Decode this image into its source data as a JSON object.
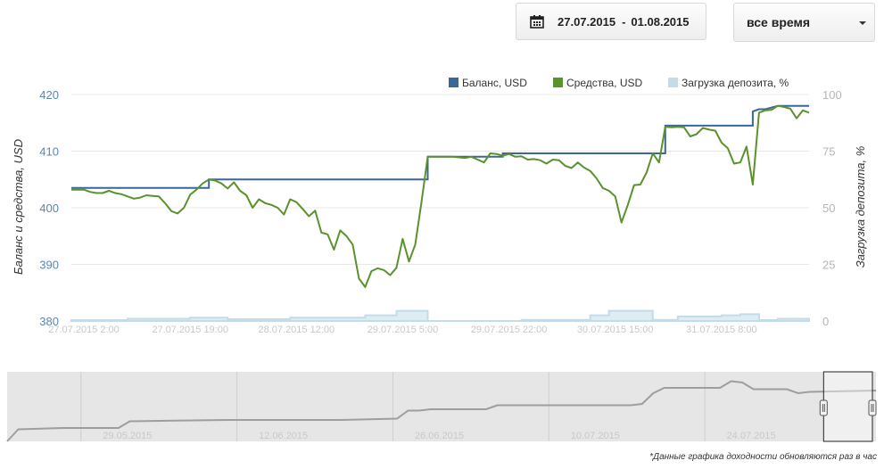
{
  "toolbar": {
    "date_from": "27.07.2015",
    "date_sep": "-",
    "date_to": "01.08.2015",
    "period_label": "все время",
    "calendar_icon": "calendar-icon",
    "dropdown_icon": "caret-down-icon"
  },
  "footnote": "*Данные графика доходности обновляются раз в час",
  "colors": {
    "balance": "#3a6797",
    "equity": "#5a922c",
    "deposit_load": "#c3dce9",
    "navigator": "#999999"
  },
  "chart_data": [
    {
      "type": "line",
      "legend_position": "top-right",
      "grid": true,
      "ylabel": "Баланс и средства, USD",
      "ylabel_right": "Загрузка депозита, %",
      "ylim": [
        380,
        420
      ],
      "yticks": [
        380,
        390,
        400,
        410,
        420
      ],
      "ylim_right": [
        0,
        100
      ],
      "yticks_right": [
        0,
        25,
        50,
        75,
        100
      ],
      "xlim": [
        0,
        118
      ],
      "x_unit": "hours since 27.07.2015 00:00",
      "xtick_labels": [
        {
          "x": 2,
          "label": "27.07.2015 2:00"
        },
        {
          "x": 19,
          "label": "27.07.2015 19:00"
        },
        {
          "x": 36,
          "label": "28.07.2015 12:00"
        },
        {
          "x": 53,
          "label": "29.07.2015 5:00"
        },
        {
          "x": 70,
          "label": "29.07.2015 22:00"
        },
        {
          "x": 87,
          "label": "30.07.2015 15:00"
        },
        {
          "x": 104,
          "label": "31.07.2015 8:00"
        }
      ],
      "series": [
        {
          "name": "Баланс, USD",
          "axis": "left",
          "x": [
            0,
            22,
            22,
            57,
            57,
            69,
            69,
            95,
            95,
            109,
            109,
            110,
            111,
            113,
            118
          ],
          "y": [
            403.5,
            403.5,
            405,
            405,
            409,
            409,
            409.6,
            409.6,
            414.5,
            414.5,
            417,
            417.4,
            417.4,
            418,
            418
          ]
        },
        {
          "name": "Средства, USD",
          "axis": "left",
          "x": [
            0,
            2,
            3,
            4,
            5,
            6,
            7,
            8,
            9,
            10,
            11,
            12,
            13,
            14,
            15,
            16,
            17,
            18,
            19,
            20,
            21,
            22,
            23,
            24,
            25,
            26,
            27,
            28,
            29,
            30,
            31,
            32,
            33,
            34,
            35,
            36,
            37,
            38,
            39,
            40,
            41,
            42,
            43,
            44,
            45,
            46,
            47,
            48,
            49,
            50,
            51,
            52,
            53,
            54,
            55,
            56,
            57,
            58,
            59,
            60,
            61,
            62,
            63,
            64,
            65,
            66,
            67,
            68,
            69,
            70,
            71,
            72,
            73,
            74,
            75,
            76,
            77,
            78,
            79,
            80,
            81,
            82,
            83,
            84,
            85,
            86,
            87,
            88,
            89,
            90,
            91,
            92,
            93,
            94,
            95,
            96,
            97,
            98,
            99,
            100,
            101,
            102,
            103,
            104,
            105,
            106,
            107,
            108,
            109,
            110,
            111,
            112,
            113,
            114,
            115,
            116,
            117,
            118
          ],
          "y": [
            403.2,
            403.2,
            402.8,
            402.6,
            402.6,
            403.0,
            402.6,
            402.4,
            402.0,
            401.6,
            401.8,
            402.2,
            402.1,
            402.0,
            400.8,
            399.4,
            399.0,
            400.0,
            402.3,
            403.2,
            404.3,
            405.0,
            404.8,
            404.3,
            403.4,
            404.5,
            403.0,
            402.2,
            400.0,
            401.5,
            400.8,
            400.5,
            400.0,
            398.8,
            401.5,
            401.0,
            399.8,
            398.5,
            399.5,
            395.6,
            395.3,
            392.6,
            396.0,
            395.0,
            393.5,
            387.5,
            386.0,
            388.8,
            389.3,
            389.0,
            388.1,
            389.4,
            394.5,
            390.5,
            393.5,
            401.0,
            409.0,
            409.0,
            409.0,
            409.0,
            409.0,
            408.9,
            408.8,
            409.0,
            408.5,
            408.0,
            409.6,
            409.5,
            409.2,
            409.5,
            409.0,
            409.1,
            408.5,
            408.6,
            408.4,
            407.8,
            408.5,
            408.4,
            407.4,
            407.0,
            408.0,
            407.1,
            406.5,
            405.2,
            403.5,
            403.0,
            402.0,
            397.4,
            400.5,
            404.0,
            404.1,
            406.2,
            409.6,
            408.0,
            414.3,
            414.2,
            414.3,
            414.2,
            412.6,
            413.0,
            414.1,
            413.8,
            413.6,
            411.5,
            410.5,
            407.8,
            408.0,
            410.8,
            404.1,
            416.8,
            417.2,
            417.3,
            418.0,
            417.8,
            417.5,
            415.8,
            417.2,
            416.8
          ]
        },
        {
          "name": "Загрузка депозита, %",
          "axis": "right",
          "x": [
            0,
            9,
            9,
            19,
            19,
            25,
            25,
            35,
            35,
            47,
            47,
            52,
            52,
            57,
            57,
            72,
            72,
            83,
            83,
            86,
            86,
            93,
            93,
            97,
            97,
            104,
            104,
            107,
            107,
            110,
            110,
            113,
            113,
            118
          ],
          "y": [
            0.4,
            0.4,
            1,
            1,
            1.5,
            1.5,
            0.8,
            0.8,
            1.5,
            1.5,
            2.5,
            2.5,
            4.5,
            4.5,
            0,
            0,
            0.5,
            0.5,
            2.5,
            2.5,
            4.5,
            4.5,
            0.5,
            0.5,
            2,
            2,
            2.5,
            2.5,
            3,
            3,
            0.4,
            0.4,
            1,
            1
          ]
        }
      ]
    },
    {
      "type": "area",
      "x_unit": "days since 15.05.2015",
      "xlim": [
        0,
        78
      ],
      "xtick_labels": [
        {
          "x": 14,
          "label": "29.05.2015"
        },
        {
          "x": 28,
          "label": "12.06.2015"
        },
        {
          "x": 42,
          "label": "26.06.2015"
        },
        {
          "x": 56,
          "label": "10.07.2015"
        },
        {
          "x": 70,
          "label": "24.07.2015"
        }
      ],
      "selection_range": [
        73.3,
        78
      ],
      "series": [
        {
          "name": "",
          "x": [
            0,
            1,
            5,
            10,
            11,
            15,
            20,
            25,
            30,
            35,
            36,
            37,
            38,
            43,
            44,
            45,
            51,
            52,
            53,
            56,
            57,
            58,
            59,
            60,
            64,
            65,
            66,
            67,
            70,
            71,
            72,
            78
          ],
          "y": [
            0,
            18,
            20,
            20,
            30,
            31,
            32,
            32,
            32,
            34,
            46,
            46,
            48,
            48,
            54,
            54,
            54,
            54,
            54,
            54,
            56,
            72,
            80,
            80,
            80,
            90,
            88,
            78,
            78,
            72,
            74,
            76
          ]
        }
      ]
    }
  ]
}
